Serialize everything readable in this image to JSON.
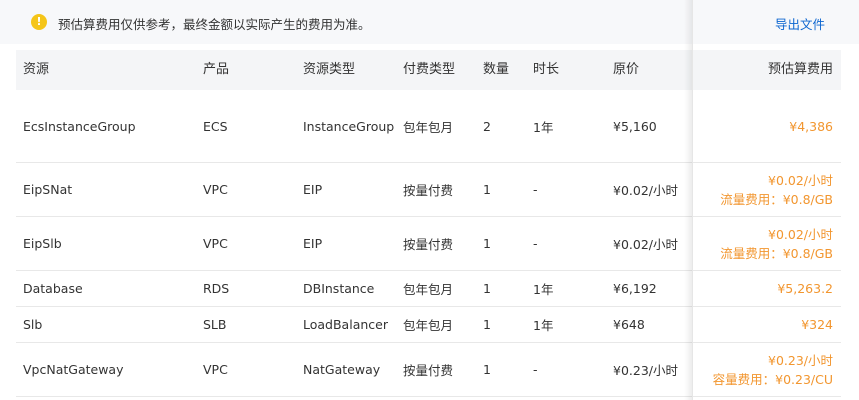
{
  "notice": {
    "icon": "warning-icon",
    "text": "预估算费用仅供参考，最终金额以实际产生的费用为准。",
    "export_label": "导出文件"
  },
  "colors": {
    "accent": "#0d66d0",
    "estimate": "#f2962f",
    "warning": "#f5c518",
    "header_bg": "#f4f5f7"
  },
  "table": {
    "headers": [
      "资源",
      "产品",
      "资源类型",
      "付费类型",
      "数量",
      "时长",
      "原价",
      "预估算费用"
    ],
    "rows": [
      {
        "resource": "EcsInstanceGroup",
        "product": "ECS",
        "type": "InstanceGroup",
        "billing": "包年包月",
        "qty": "2",
        "duration": "1年",
        "price": "¥5,160",
        "estimate": [
          "¥4,386"
        ]
      },
      {
        "resource": "EipSNat",
        "product": "VPC",
        "type": "EIP",
        "billing": "按量付费",
        "qty": "1",
        "duration": "-",
        "price": "¥0.02/小时",
        "estimate": [
          "¥0.02/小时",
          "流量费用：¥0.8/GB"
        ]
      },
      {
        "resource": "EipSlb",
        "product": "VPC",
        "type": "EIP",
        "billing": "按量付费",
        "qty": "1",
        "duration": "-",
        "price": "¥0.02/小时",
        "estimate": [
          "¥0.02/小时",
          "流量费用：¥0.8/GB"
        ]
      },
      {
        "resource": "Database",
        "product": "RDS",
        "type": "DBInstance",
        "billing": "包年包月",
        "qty": "1",
        "duration": "1年",
        "price": "¥6,192",
        "estimate": [
          "¥5,263.2"
        ]
      },
      {
        "resource": "Slb",
        "product": "SLB",
        "type": "LoadBalancer",
        "billing": "包年包月",
        "qty": "1",
        "duration": "1年",
        "price": "¥648",
        "estimate": [
          "¥324"
        ]
      },
      {
        "resource": "VpcNatGateway",
        "product": "VPC",
        "type": "NatGateway",
        "billing": "按量付费",
        "qty": "1",
        "duration": "-",
        "price": "¥0.23/小时",
        "estimate": [
          "¥0.23/小时",
          "容量费用：¥0.23/CU"
        ]
      }
    ]
  }
}
